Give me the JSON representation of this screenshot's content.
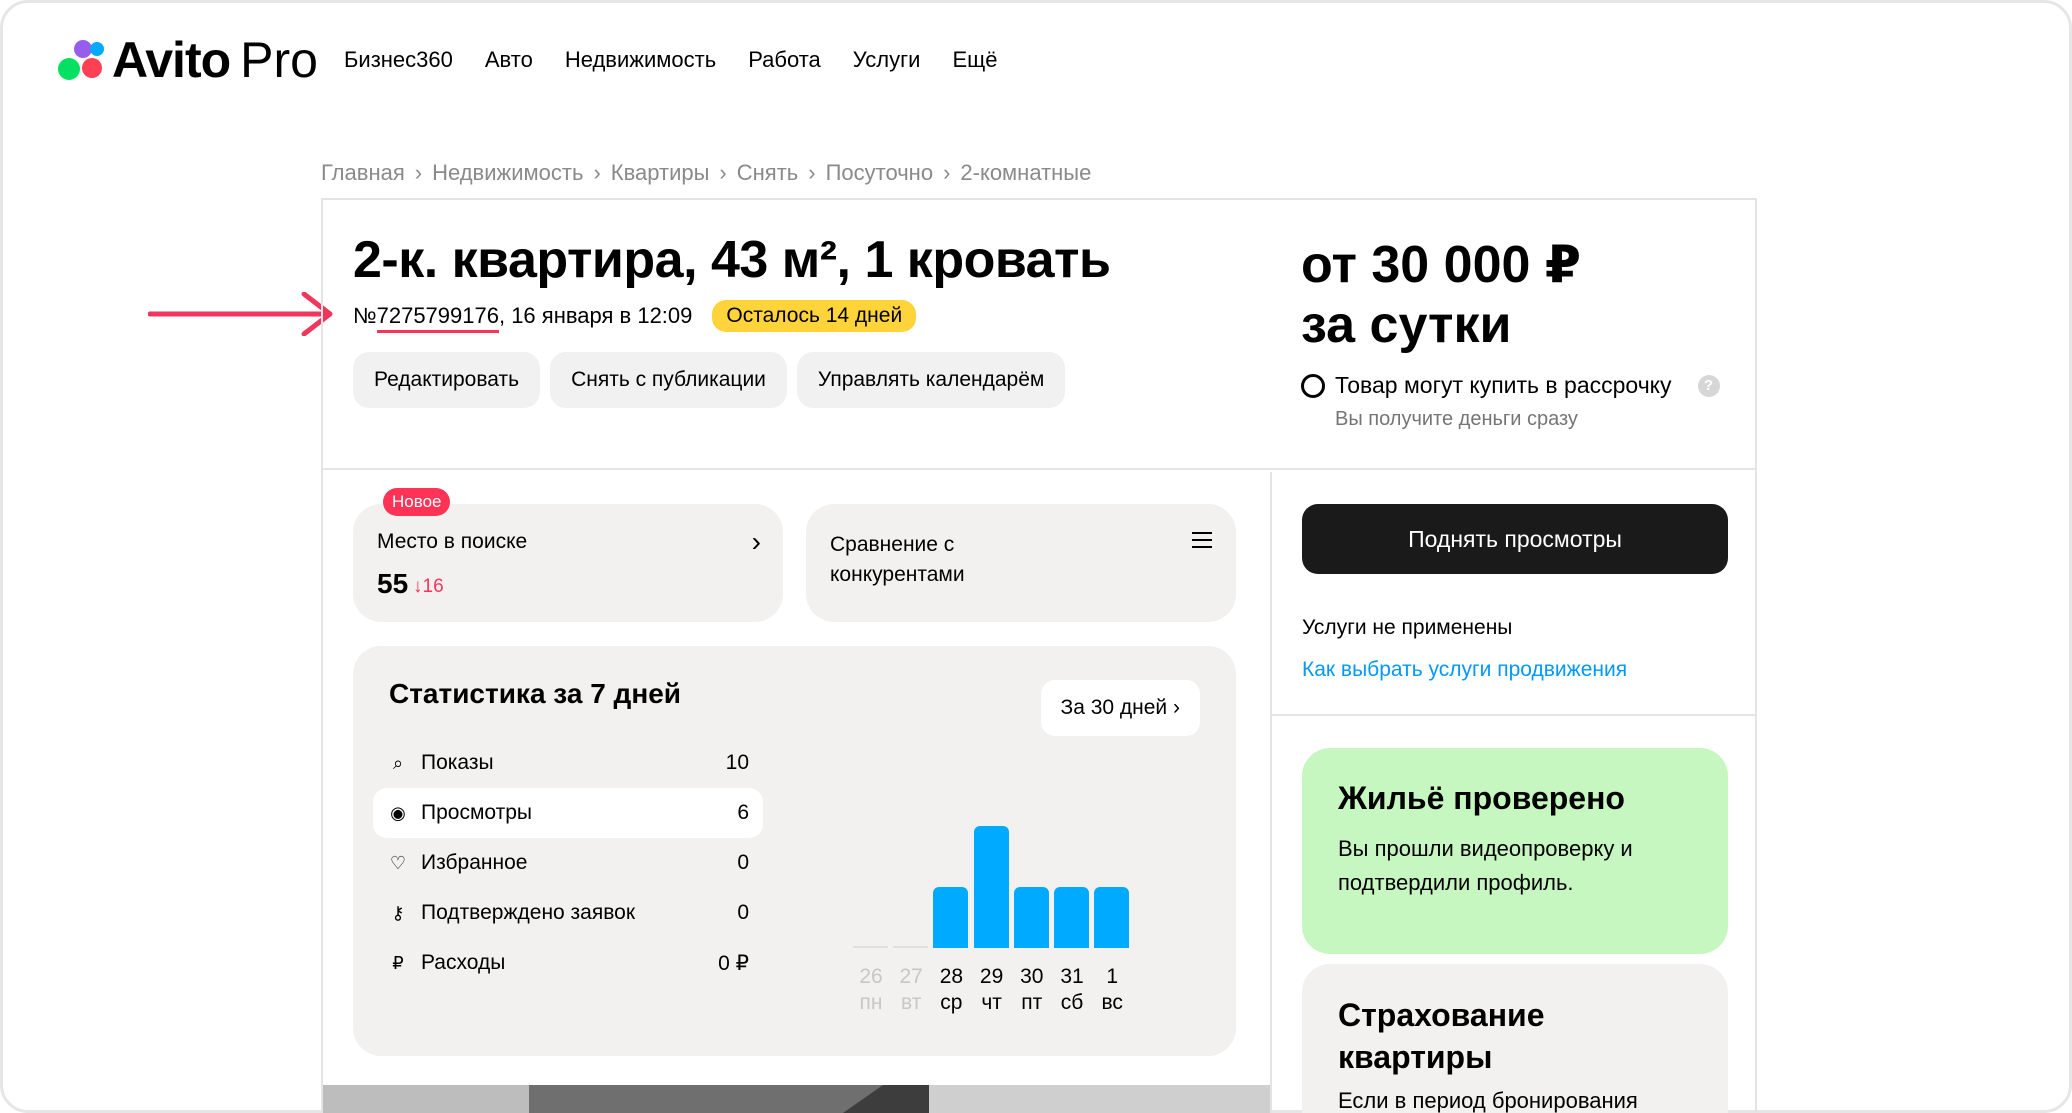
{
  "header": {
    "logo_word": "Avito",
    "logo_pro": "Pro",
    "nav": [
      "Бизнес360",
      "Авто",
      "Недвижимость",
      "Работа",
      "Услуги",
      "Ещё"
    ]
  },
  "breadcrumb": [
    "Главная",
    "Недвижимость",
    "Квартиры",
    "Снять",
    "Посуточно",
    "2-комнатные"
  ],
  "listing": {
    "title": "2-к. квартира, 43 м², 1 кровать",
    "number_prefix": "№",
    "number": "7275799176",
    "date": ", 16 января в 12:09",
    "days_left": "Осталось 14 дней",
    "actions": [
      "Редактировать",
      "Снять с публикации",
      "Управлять календарём"
    ]
  },
  "price": {
    "line1": "от 30 000 ₽",
    "line2": "за сутки",
    "installment": "Товар могут купить в рассрочку",
    "installment_sub": "Вы получите деньги сразу",
    "help": "?"
  },
  "search_position": {
    "badge": "Новое",
    "label": "Место в поиске",
    "chevron": "›",
    "value": "55",
    "delta": "↓16"
  },
  "comparison": {
    "label": "Сравнение с конкурентами"
  },
  "stats": {
    "title": "Статистика за 7 дней",
    "period_button": "За 30 дней ›",
    "rows": [
      {
        "icon": "search-icon",
        "glyph": "⌕",
        "label": "Показы",
        "value": "10"
      },
      {
        "icon": "eye-icon",
        "glyph": "◉",
        "label": "Просмотры",
        "value": "6"
      },
      {
        "icon": "heart-icon",
        "glyph": "♡",
        "label": "Избранное",
        "value": "0"
      },
      {
        "icon": "key-icon",
        "glyph": "⚷",
        "label": "Подтверждено заявок",
        "value": "0"
      },
      {
        "icon": "ruble-icon",
        "glyph": "₽",
        "label": "Расходы",
        "value": "0 ₽"
      }
    ]
  },
  "chart_data": {
    "type": "bar",
    "categories": [
      "26 пн",
      "27 вт",
      "28 ср",
      "29 чт",
      "30 пт",
      "31 сб",
      "1 вс"
    ],
    "days": [
      "26",
      "27",
      "28",
      "29",
      "30",
      "31",
      "1"
    ],
    "weekdays": [
      "пн",
      "вт",
      "ср",
      "чт",
      "пт",
      "сб",
      "вс"
    ],
    "values": [
      0,
      0,
      1,
      2,
      1,
      1,
      1
    ],
    "dim": [
      true,
      true,
      false,
      false,
      false,
      false,
      false
    ],
    "color": "#00aaff"
  },
  "promotion": {
    "boost_button": "Поднять просмотры",
    "no_services": "Услуги не применены",
    "how_link": "Как выбрать услуги продвижения"
  },
  "verified": {
    "title": "Жильё проверено",
    "text": "Вы прошли видеопроверку и подтвердили профиль."
  },
  "insurance": {
    "title": "Страхование квартиры",
    "text": "Если в период бронирования"
  },
  "colors": {
    "accent_red": "#ff3355",
    "badge_yellow": "#ffd43b",
    "link_blue": "#0099f7",
    "chart_blue": "#00aaff",
    "verified_green": "#c7f7c0"
  }
}
